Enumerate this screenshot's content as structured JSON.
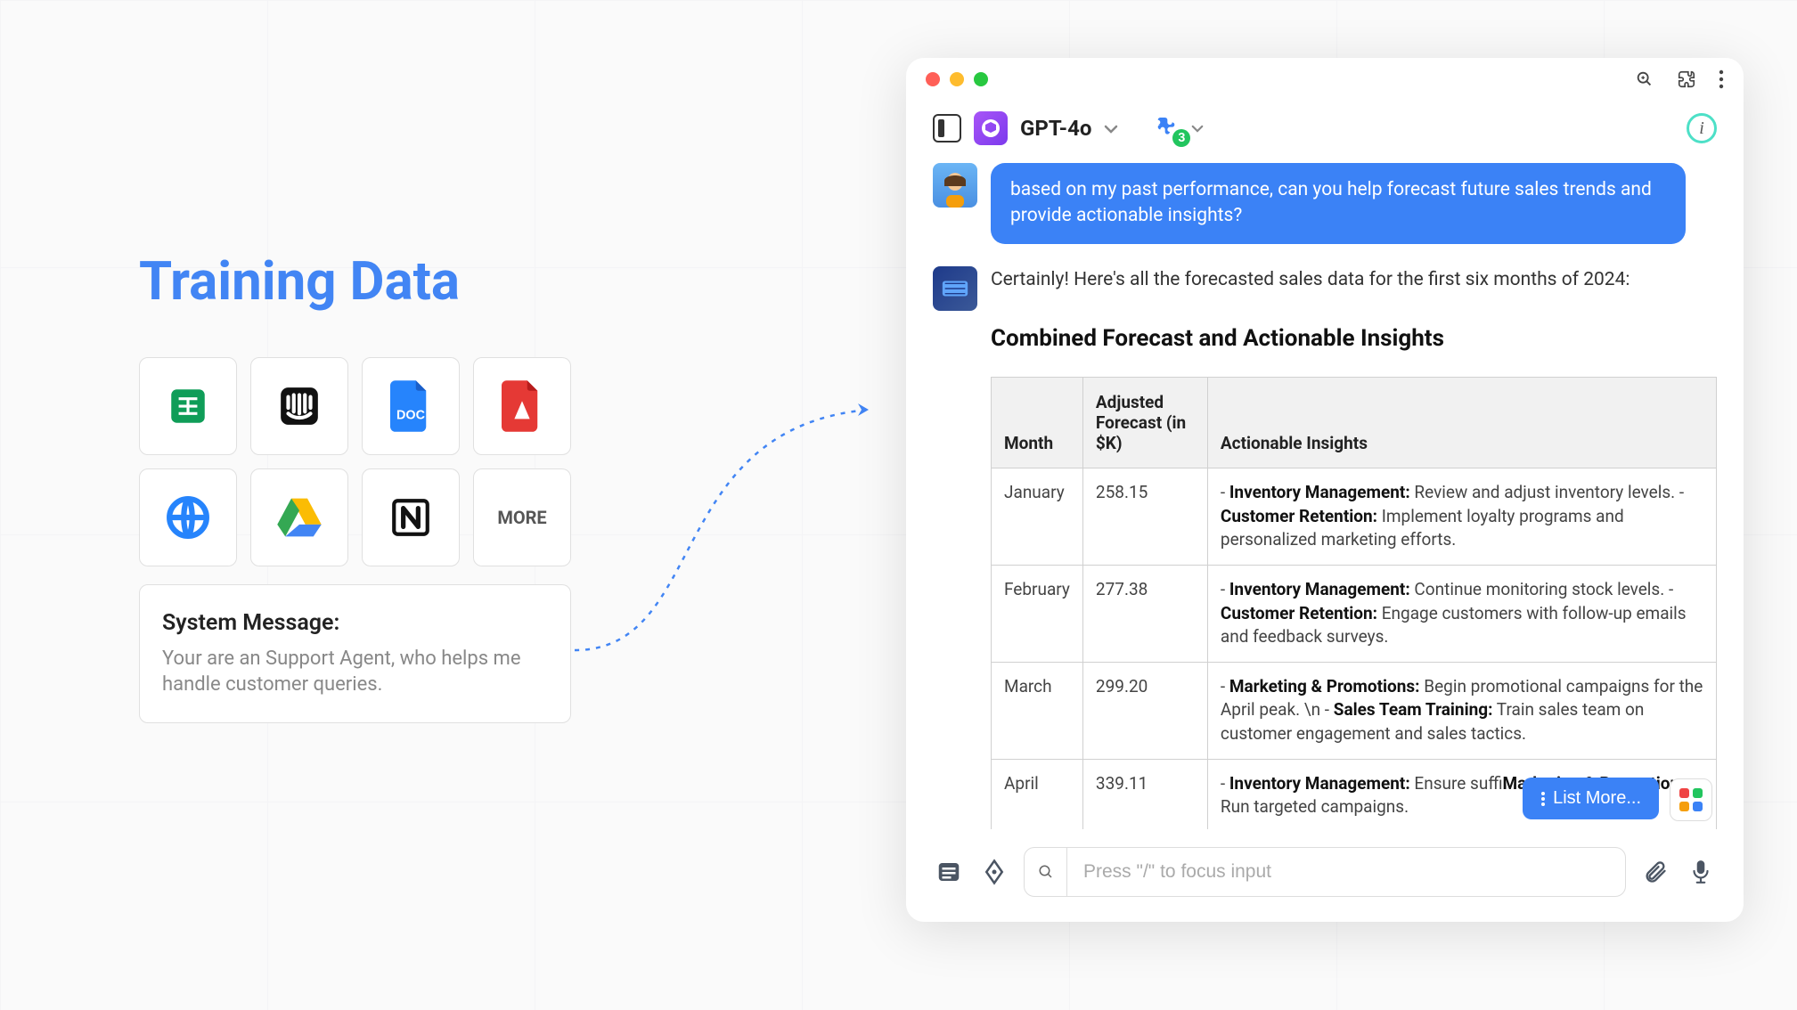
{
  "left": {
    "title": "Training Data",
    "more_label": "MORE",
    "system_message_label": "System Message:",
    "system_message_body": "Your are an Support Agent, who helps me handle customer queries."
  },
  "chat": {
    "model_name": "GPT-4o",
    "puzzle_count": "3",
    "user_message": "based on my past performance, can you help forecast future sales trends and provide actionable insights?",
    "ai_intro": "Certainly! Here's all the forecasted sales data for the first six months of 2024:",
    "section_title": "Combined Forecast and Actionable Insights",
    "table": {
      "headers": {
        "month": "Month",
        "forecast": "Adjusted Forecast (in $K)",
        "insights": "Actionable Insights"
      },
      "rows": [
        {
          "month": "January",
          "forecast": "258.15",
          "insights": [
            {
              "label": "Inventory Management:",
              "text": " Review and adjust inventory levels. - "
            },
            {
              "label": "Customer Retention:",
              "text": " Implement loyalty programs and personalized marketing efforts."
            }
          ]
        },
        {
          "month": "February",
          "forecast": "277.38",
          "insights": [
            {
              "label": "Inventory Management:",
              "text": " Continue monitoring stock levels. - "
            },
            {
              "label": "Customer Retention:",
              "text": " Engage customers with follow-up emails and feedback surveys."
            }
          ]
        },
        {
          "month": "March",
          "forecast": "299.20",
          "insights": [
            {
              "label": "Marketing & Promotions:",
              "text": " Begin promotional campaigns for the April peak. \\n - "
            },
            {
              "label": "Sales Team Training:",
              "text": " Train sales team on customer engagement and sales tactics."
            }
          ]
        },
        {
          "month": "April",
          "forecast": "339.11",
          "insights": [
            {
              "label": "Inventory Management:",
              "text": " Ensure suffi"
            },
            {
              "label": "Marketing & Promotions:",
              "text": " Run targeted campaigns."
            }
          ]
        }
      ]
    },
    "list_more_label": "List More...",
    "input_placeholder": "Press \"/\" to focus input"
  }
}
